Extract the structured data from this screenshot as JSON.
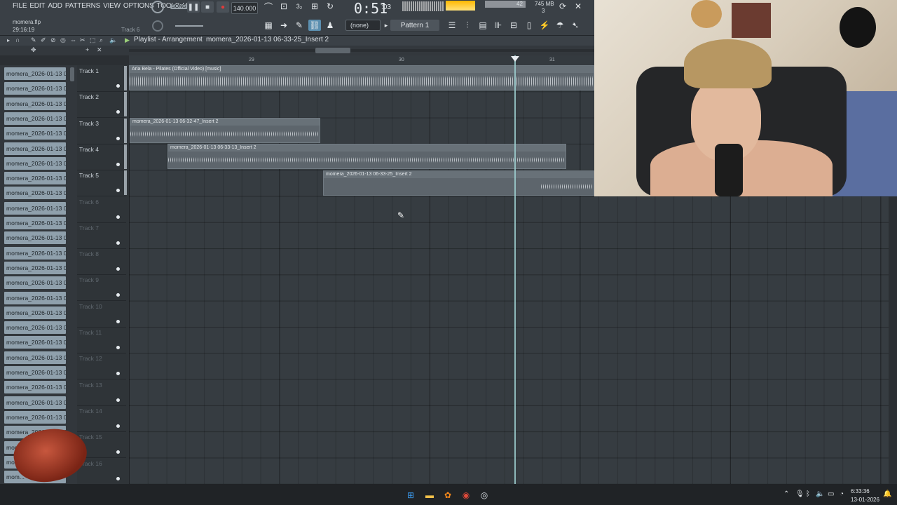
{
  "menu": [
    "FILE",
    "EDIT",
    "ADD",
    "PATTERNS",
    "VIEW",
    "OPTIONS",
    "TOOLS",
    "HELP"
  ],
  "transport": {
    "song_label": "SONG",
    "tempo": "140.000",
    "time": "0:51",
    "time_sub": ":03",
    "cpu_top": "42",
    "mem": "745 MB",
    "mem_sub": "3"
  },
  "project": {
    "filename": "momera.flp",
    "position": "29:16:19",
    "hint": "Track 6"
  },
  "toolbar2": {
    "snap": "(none)",
    "pattern": "Pattern 1"
  },
  "playlist": {
    "title": "Playlist - Arrangement",
    "breadcrumb": "momera_2026-01-13 06-33-25_Insert 2"
  },
  "ruler": [
    "29",
    "30",
    "31"
  ],
  "picker": {
    "items": [
      "momera_2026-01-13 06...",
      "momera_2026-01-13 06...",
      "momera_2026-01-13 06...",
      "momera_2026-01-13 06...",
      "momera_2026-01-13 06...",
      "momera_2026-01-13 06...",
      "momera_2026-01-13 06...",
      "momera_2026-01-13 06...",
      "momera_2026-01-13 06...",
      "momera_2026-01-13 06...",
      "momera_2026-01-13 06...",
      "momera_2026-01-13 06...",
      "momera_2026-01-13 06...",
      "momera_2026-01-13 06...",
      "momera_2026-01-13 06...",
      "momera_2026-01-13 06...",
      "momera_2026-01-13 06...",
      "momera_2026-01-13 06...",
      "momera_2026-01-13 06...",
      "momera_2026-01-13 06...",
      "momera_2026-01-13 06...",
      "momera_2026-01-13 06...",
      "momera_2026-01-13 06...",
      "momera_2026-01-13 06...",
      "momera_2026-01-13 06...",
      "momera_2026-01-13 06...",
      "mom...",
      "mom...",
      "momera_..."
    ]
  },
  "tracks": [
    "Track 1",
    "Track 2",
    "Track 3",
    "Track 4",
    "Track 5",
    "Track 6",
    "Track 7",
    "Track 8",
    "Track 9",
    "Track 10",
    "Track 11",
    "Track 12",
    "Track 13",
    "Track 14",
    "Track 15",
    "Track 16"
  ],
  "clips": {
    "c1": "Aria Bela - Pilates (Official Video) [music]",
    "c3": "momera_2026-01-13 06-32-47_Insert 2",
    "c4": "momera_2026-01-13 06-33-13_Insert 2",
    "c5": "momera_2026-01-13 06-33-25_Insert 2"
  },
  "taskbar": {
    "time": "6:33:36",
    "date": "13-01-2026"
  }
}
